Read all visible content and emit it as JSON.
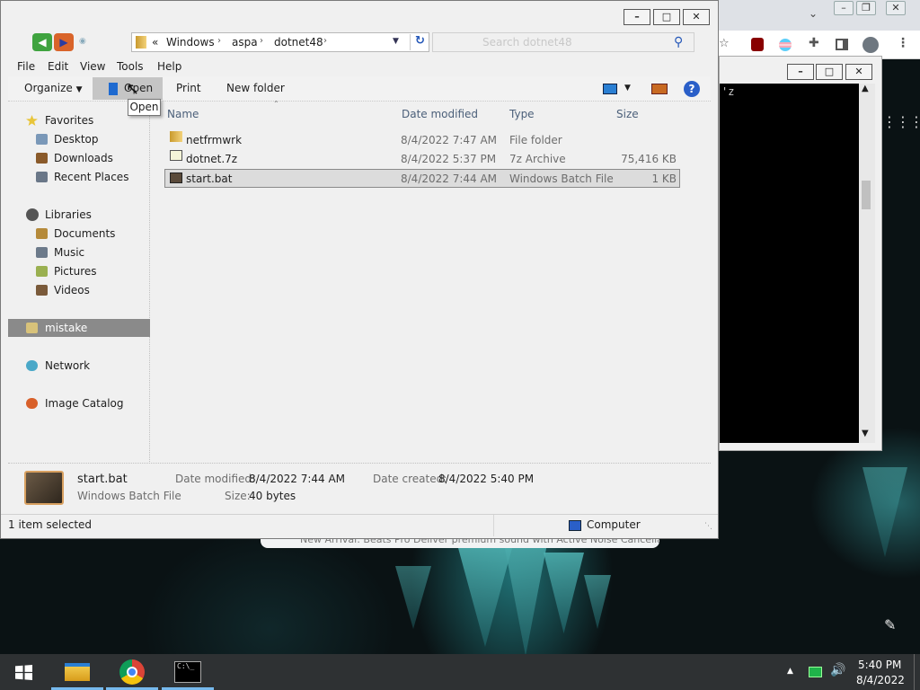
{
  "explorer": {
    "breadcrumb": [
      "Windows",
      "aspa",
      "dotnet48"
    ],
    "breadcrumb_prefix": "«",
    "search_placeholder": "Search dotnet48",
    "menu": [
      "File",
      "Edit",
      "View",
      "Tools",
      "Help"
    ],
    "commands": {
      "organize": "Organize",
      "open": "Open",
      "print": "Print",
      "new_folder": "New folder"
    },
    "tooltip": "Open",
    "nav": {
      "favorites": "Favorites",
      "desktop": "Desktop",
      "downloads": "Downloads",
      "recent": "Recent Places",
      "libraries": "Libraries",
      "documents": "Documents",
      "music": "Music",
      "pictures": "Pictures",
      "videos": "Videos",
      "user": "mistake",
      "network": "Network",
      "image_catalog": "Image Catalog"
    },
    "columns": {
      "name": "Name",
      "date": "Date modified",
      "type": "Type",
      "size": "Size"
    },
    "files": [
      {
        "name": "netfrmwrk",
        "date": "8/4/2022 7:47 AM",
        "type": "File folder",
        "size": ""
      },
      {
        "name": "dotnet.7z",
        "date": "8/4/2022 5:37 PM",
        "type": "7z Archive",
        "size": "75,416 KB"
      },
      {
        "name": "start.bat",
        "date": "8/4/2022 7:44 AM",
        "type": "Windows Batch File",
        "size": "1 KB"
      }
    ],
    "details": {
      "name": "start.bat",
      "type": "Windows Batch File",
      "modified_label": "Date modified:",
      "modified": "8/4/2022 7:44 AM",
      "created_label": "Date created:",
      "created": "8/4/2022 5:40 PM",
      "size_label": "Size:",
      "size": "40 bytes"
    },
    "status": {
      "selected": "1 item selected",
      "location": "Computer"
    }
  },
  "console": {
    "text": "'z"
  },
  "browser_notification": "New Arrival: Beats Pro Deliver premium sound with Active Noise Cancellation",
  "taskbar": {
    "time": "5:40 PM",
    "date": "8/4/2022"
  },
  "colors": {
    "accent": "#76b9ed",
    "selected_nav": "#8a8a8a",
    "taskbar": "#2e3133"
  }
}
